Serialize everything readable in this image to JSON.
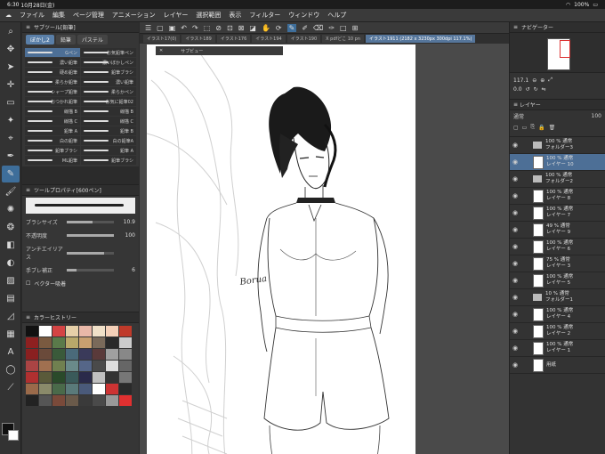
{
  "statusbar": {
    "time": "6:30",
    "date": "10月28日(金)",
    "battery": "100%"
  },
  "menu": [
    "ファイル",
    "編集",
    "ページ管理",
    "アニメーション",
    "レイヤー",
    "選択範囲",
    "表示",
    "フィルター",
    "ウィンドウ",
    "ヘルプ"
  ],
  "subtool": {
    "header": "サブツール[鉛筆]",
    "tabs": [
      "ぼかし2",
      "鉛筆",
      "パステル"
    ],
    "brushes": [
      {
        "name": "Gペン"
      },
      {
        "name": "お気鉛筆ペン"
      },
      {
        "name": "濃い鉛筆"
      },
      {
        "name": "濃いぼかしペン"
      },
      {
        "name": "硬め鉛筆"
      },
      {
        "name": "鉛筆ブラシ"
      },
      {
        "name": "柔らか鉛筆"
      },
      {
        "name": "濃い鉛筆"
      },
      {
        "name": "シャープ鉛筆"
      },
      {
        "name": "柔らかペン"
      },
      {
        "name": "おつかれ鉛筆"
      },
      {
        "name": "お気に鉛筆02"
      },
      {
        "name": "線描 B"
      },
      {
        "name": "線描 B"
      },
      {
        "name": "線描 C"
      },
      {
        "name": "線描 C"
      },
      {
        "name": "鉛筆 A"
      },
      {
        "name": "鉛筆 B"
      },
      {
        "name": "白の鉛筆"
      },
      {
        "name": "白の鉛筆A"
      },
      {
        "name": "鉛筆ブラシ"
      },
      {
        "name": "鉛筆 A"
      },
      {
        "name": "ML鉛筆"
      },
      {
        "name": "鉛筆ブラシ"
      }
    ]
  },
  "toolprop": {
    "header": "ツールプロパティ[600ペン]",
    "rows": [
      {
        "label": "ブラシサイズ",
        "value": "10.9",
        "fill": 0.55
      },
      {
        "label": "不透明度",
        "value": "100",
        "fill": 1.0
      },
      {
        "label": "アンチエイリアス",
        "value": "",
        "fill": 0.8
      },
      {
        "label": "手ブレ補正",
        "value": "6",
        "fill": 0.2
      }
    ],
    "vector_label": "ベクター吸着"
  },
  "colorhistory": {
    "header": "カラーヒストリー",
    "swatches": [
      "#111111",
      "#ffffff",
      "#d44444",
      "#e6cfa8",
      "#e9b8a8",
      "#f0e0c8",
      "#f4d0b8",
      "#c03a2a",
      "#8e2020",
      "#7a5a40",
      "#5a7a4a",
      "#b8a86a",
      "#c8a070",
      "#7a6a5a",
      "#2a2a2a",
      "#cccccc",
      "#8a2020",
      "#6a4a3a",
      "#3a5a3a",
      "#4a6a7a",
      "#3a3a5a",
      "#5a3a3a",
      "#a0a0a0",
      "#888888",
      "#aa4444",
      "#a07050",
      "#708050",
      "#6a8a8a",
      "#556688",
      "#4a4a4a",
      "#dddddd",
      "#666666",
      "#b03030",
      "#5a5a3a",
      "#2a4a2a",
      "#3a5a5a",
      "#2a2a4a",
      "#c0c0c0",
      "#333333",
      "#777777",
      "#9a6a4a",
      "#8a8a6a",
      "#4a6a4a",
      "#5a7a7a",
      "#4a5a7a",
      "#ffffff",
      "#cc3333",
      "#2a2a2a",
      "#222222",
      "#555555",
      "#7a4a3a",
      "#6a5a4a",
      "#3a3a3a",
      "#4a4a4a",
      "#999999",
      "#e03030"
    ]
  },
  "canvas": {
    "toolbar_icons": [
      "menu-icon",
      "undo-icon",
      "redo-icon",
      "pencil-icon",
      "brush-icon",
      "eraser-icon"
    ],
    "tabs": [
      "イラスト17(0)",
      "イラスト189",
      "イラスト176",
      "イラスト194",
      "イラスト190",
      "X pdfどこ 10 pn",
      "イラスト1911 (2182 x 3230px 300dpi 117.1%)"
    ],
    "subview_close": "✕",
    "subview_label": "サブビュー",
    "signature": "Borua"
  },
  "navigator": {
    "header": "ナビゲーター",
    "zoom": "117.1",
    "angle": "0.0"
  },
  "layers": {
    "header": "レイヤー",
    "blend_mode": "通常",
    "opacity": "100",
    "items": [
      {
        "opacity": "100 %",
        "mode": "通常",
        "name": "フォルダー3",
        "type": "folder",
        "selected": false
      },
      {
        "opacity": "100 %",
        "mode": "通常",
        "name": "レイヤー 10",
        "type": "layer",
        "selected": true
      },
      {
        "opacity": "100 %",
        "mode": "通常",
        "name": "フォルダー2",
        "type": "folder",
        "selected": false
      },
      {
        "opacity": "100 %",
        "mode": "通常",
        "name": "レイヤー 8",
        "type": "layer",
        "selected": false
      },
      {
        "opacity": "100 %",
        "mode": "通常",
        "name": "レイヤー 7",
        "type": "layer",
        "selected": false
      },
      {
        "opacity": "49 %",
        "mode": "通常",
        "name": "レイヤー 9",
        "type": "layer",
        "selected": false
      },
      {
        "opacity": "100 %",
        "mode": "通常",
        "name": "レイヤー 6",
        "type": "layer",
        "selected": false
      },
      {
        "opacity": "75 %",
        "mode": "通常",
        "name": "レイヤー 3",
        "type": "layer",
        "selected": false
      },
      {
        "opacity": "100 %",
        "mode": "通常",
        "name": "レイヤー 5",
        "type": "layer",
        "selected": false
      },
      {
        "opacity": "10 %",
        "mode": "通常",
        "name": "フォルダー1",
        "type": "folder",
        "selected": false
      },
      {
        "opacity": "100 %",
        "mode": "通常",
        "name": "レイヤー 4",
        "type": "layer",
        "selected": false
      },
      {
        "opacity": "100 %",
        "mode": "通常",
        "name": "レイヤー 2",
        "type": "layer",
        "selected": false
      },
      {
        "opacity": "100 %",
        "mode": "通常",
        "name": "レイヤー 1",
        "type": "layer",
        "selected": false
      },
      {
        "opacity": "",
        "mode": "",
        "name": "用紙",
        "type": "paper",
        "selected": false
      }
    ]
  }
}
